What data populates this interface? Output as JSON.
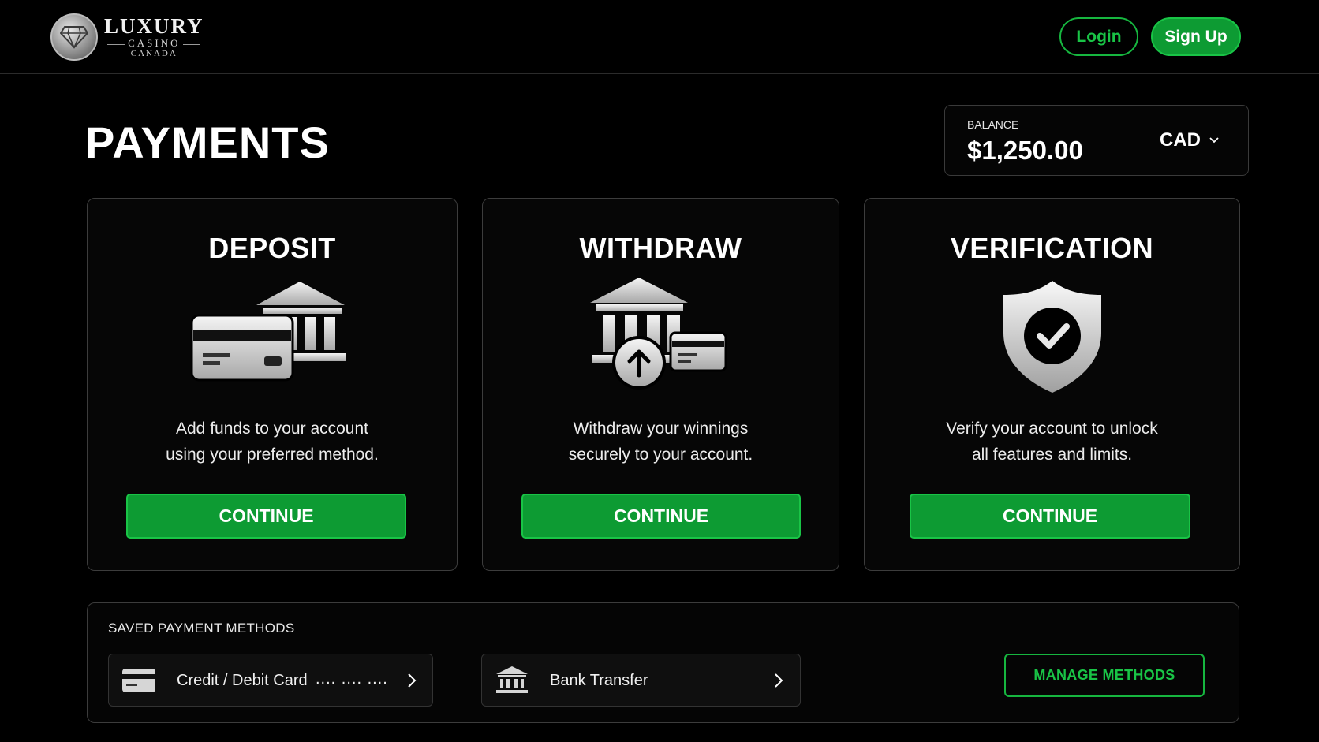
{
  "brand": {
    "line1": "LUXURY",
    "line2": "CASINO",
    "line3": "CANADA"
  },
  "header": {
    "login_label": "Login",
    "signup_label": "Sign Up"
  },
  "page": {
    "title": "PAYMENTS"
  },
  "balance": {
    "label": "BALANCE",
    "amount": "$1,250.00",
    "currency": "CAD"
  },
  "cards": [
    {
      "title": "DEPOSIT",
      "icon": "card-bank-icon",
      "desc_line1": "Add funds to your account",
      "desc_line2": "using your preferred method.",
      "button": "CONTINUE"
    },
    {
      "title": "WITHDRAW",
      "icon": "bank-withdraw-icon",
      "desc_line1": "Withdraw your winnings",
      "desc_line2": "securely to your account.",
      "button": "CONTINUE"
    },
    {
      "title": "VERIFICATION",
      "icon": "shield-check-icon",
      "desc_line1": "Verify your account to unlock",
      "desc_line2": "all features and limits.",
      "button": "CONTINUE"
    }
  ],
  "saved_methods": {
    "title": "SAVED PAYMENT METHODS",
    "items": [
      {
        "label": "Credit / Debit Card",
        "masked": ".... .... ....",
        "icon": "credit-card-icon"
      },
      {
        "label": "Bank Transfer",
        "icon": "bank-icon"
      }
    ],
    "manage_label": "MANAGE METHODS"
  },
  "colors": {
    "accent_green": "#0d9b33",
    "accent_green_text": "#19c446",
    "background": "#000000"
  }
}
